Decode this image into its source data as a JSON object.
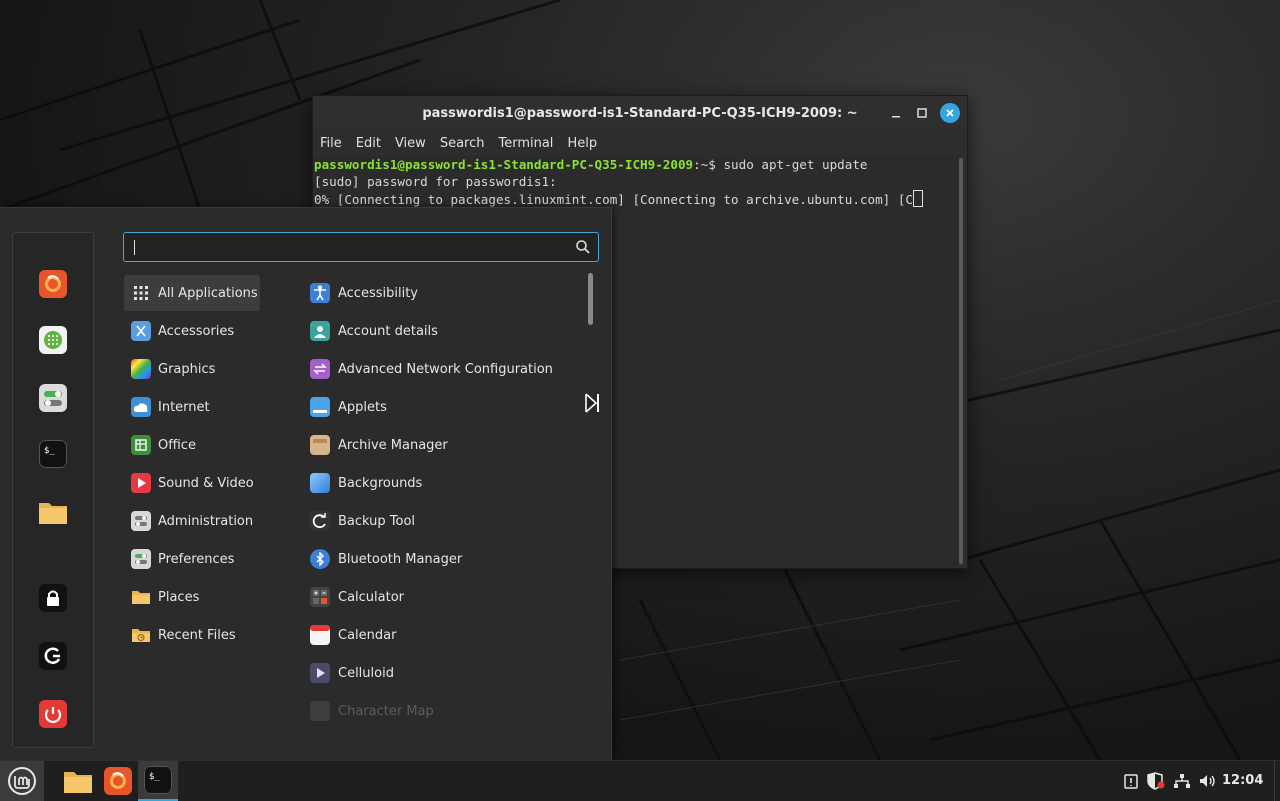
{
  "terminal": {
    "title": "passwordis1@password-is1-Standard-PC-Q35-ICH9-2009: ~",
    "menu": [
      "File",
      "Edit",
      "View",
      "Search",
      "Terminal",
      "Help"
    ],
    "prompt_user": "passwordis1@password-is1-Standard-PC-Q35-ICH9-2009",
    "prompt_path": ":~$ ",
    "command": "sudo apt-get update",
    "line2": "[sudo] password for passwordis1:",
    "line3": "0% [Connecting to packages.linuxmint.com] [Connecting to archive.ubuntu.com] [C"
  },
  "menu": {
    "search_value": "",
    "favorites": [
      "firefox-icon",
      "app-grid-icon",
      "settings-toggle-icon",
      "terminal-icon",
      "folder-icon"
    ],
    "session": [
      "lock-icon",
      "logout-icon",
      "power-icon"
    ],
    "categories": [
      "All Applications",
      "Accessories",
      "Graphics",
      "Internet",
      "Office",
      "Sound & Video",
      "Administration",
      "Preferences",
      "Places",
      "Recent Files"
    ],
    "apps": [
      "Accessibility",
      "Account details",
      "Advanced Network Configuration",
      "Applets",
      "Archive Manager",
      "Backgrounds",
      "Backup Tool",
      "Bluetooth Manager",
      "Calculator",
      "Calendar",
      "Celluloid",
      "Character Map"
    ]
  },
  "taskbar": {
    "clock": "12:04"
  },
  "colors": {
    "accent": "#35a4df",
    "prompt_green": "#8ae234",
    "menu_bg": "#2b2b2b"
  }
}
